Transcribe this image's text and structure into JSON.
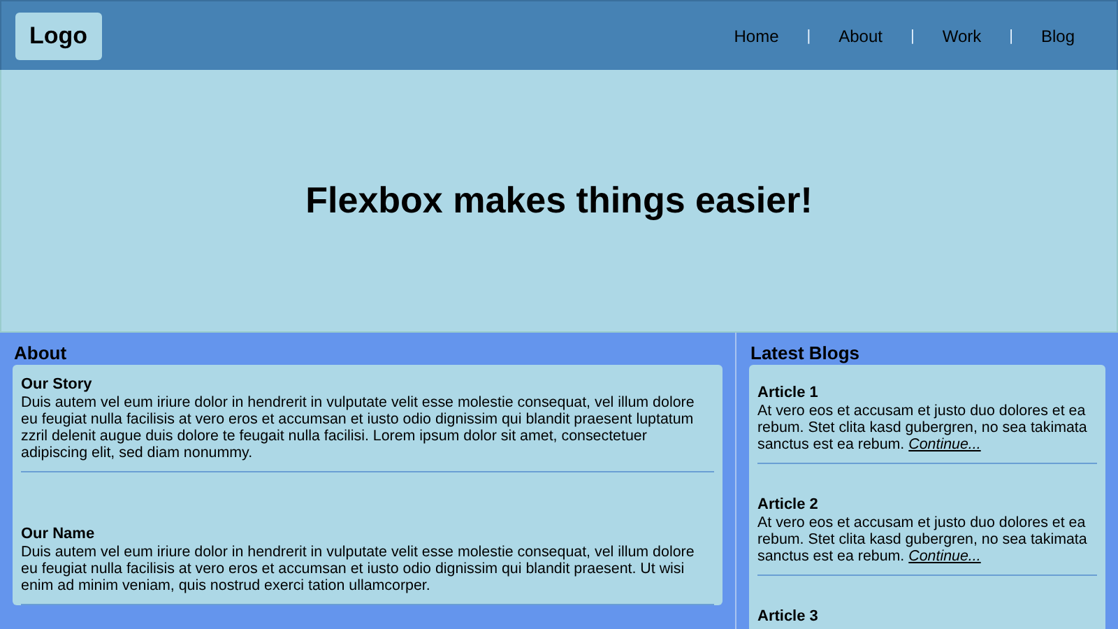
{
  "header": {
    "logo": "Logo",
    "nav": [
      {
        "label": "Home"
      },
      {
        "label": "About"
      },
      {
        "label": "Work"
      },
      {
        "label": "Blog"
      }
    ],
    "separator": "|"
  },
  "hero": {
    "title": "Flexbox makes things easier!"
  },
  "about": {
    "heading": "About",
    "items": [
      {
        "title": "Our Story",
        "text": "Duis autem vel eum iriure dolor in hendrerit in vulputate velit esse molestie consequat, vel illum dolore eu feugiat nulla facilisis at vero eros et accumsan et iusto odio dignissim qui blandit praesent luptatum zzril delenit augue duis dolore te feugait nulla facilisi. Lorem ipsum dolor sit amet, consectetuer adipiscing elit, sed diam nonummy."
      },
      {
        "title": "Our Name",
        "text": "Duis autem vel eum iriure dolor in hendrerit in vulputate velit esse molestie consequat, vel illum dolore eu feugiat nulla facilisis at vero eros et accumsan et iusto odio dignissim qui blandit praesent. Ut wisi enim ad minim veniam, quis nostrud exerci tation ullamcorper."
      }
    ]
  },
  "blogs": {
    "heading": "Latest Blogs",
    "items": [
      {
        "title": "Article 1",
        "text": "At vero eos et accusam et justo duo dolores et ea rebum. Stet clita kasd gubergren, no sea takimata sanctus est ea rebum.",
        "link": "Continue..."
      },
      {
        "title": "Article 2",
        "text": "At vero eos et accusam et justo duo dolores et ea rebum. Stet clita kasd gubergren, no sea takimata sanctus est ea rebum.",
        "link": "Continue..."
      },
      {
        "title": "Article 3"
      }
    ]
  }
}
